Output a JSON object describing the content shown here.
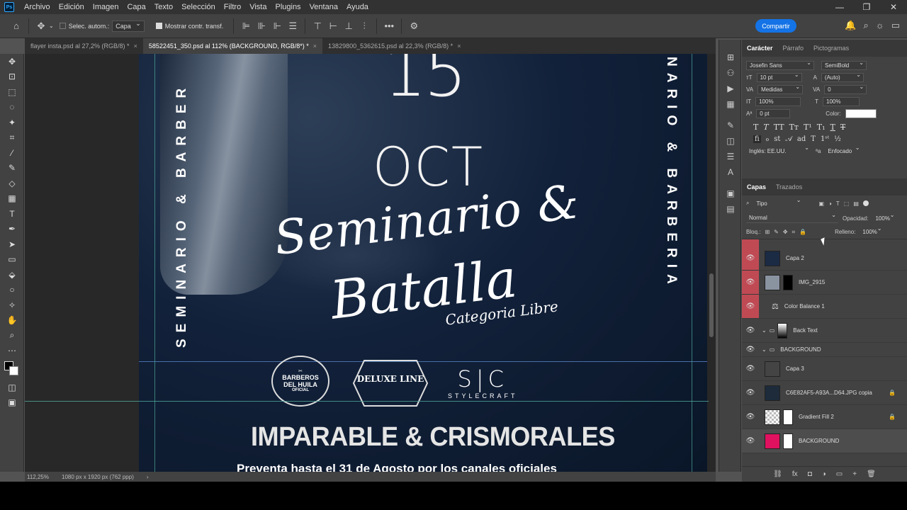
{
  "menubar": {
    "logo": "Ps",
    "items": [
      "Archivo",
      "Edición",
      "Imagen",
      "Capa",
      "Texto",
      "Selección",
      "Filtro",
      "Vista",
      "Plugins",
      "Ventana",
      "Ayuda"
    ],
    "minimize": "—",
    "restore": "❐",
    "close": "✕"
  },
  "options": {
    "auto_select_label": "Selec. autom.:",
    "auto_select_value": "Capa",
    "show_transform_label": "Mostrar contr. transf.",
    "more": "•••",
    "share_label": "Compartir"
  },
  "tabs": [
    {
      "label": "flayer insta.psd al 27,2% (RGB/8) *",
      "close": "×"
    },
    {
      "label": "58522451_350.psd al 112% (BACKGROUND, RGB/8*) *",
      "close": "×"
    },
    {
      "label": "13829800_5362615.psd al 22,3% (RGB/8) *",
      "close": "×"
    }
  ],
  "artwork": {
    "day": "15",
    "month": "OCT",
    "script_line1": "Seminario &",
    "script_line2": "Batalla",
    "script_line3": "Categoria Libre",
    "left_vertical": "SEMINARIO & BARBER",
    "right_vertical": "NARIO & BARBERIA",
    "logo1_line1": "BARBEROS",
    "logo1_line2": "DEL HUILA",
    "logo1_line3": "OFICIAL",
    "logo2": "DELUXE LINE",
    "logo3_big": "S|C",
    "logo3_small": "STYLECRAFT",
    "headline": "IMPARABLE & CRISMORALES",
    "subline": "Preventa hasta el 31 de Agosto por los canales oficiales"
  },
  "status": {
    "zoom": "112,25%",
    "doc_info": "1080 px x 1920 px (762 ppp)",
    "arrow": "›"
  },
  "character_panel": {
    "tabs": [
      "Carácter",
      "Párrafo",
      "Pictogramas"
    ],
    "font_family": "Josefin Sans",
    "font_style": "SemiBold",
    "font_size": "10 pt",
    "leading": "(Auto)",
    "kerning": "Medidas",
    "tracking": "0",
    "vertical_scale": "100%",
    "horizontal_scale": "100%",
    "baseline_shift": "0 pt",
    "color_label": "Color:",
    "color_value": "#ffffff",
    "type_buttons": [
      "T",
      "T",
      "TT",
      "Tт",
      "T¹",
      "T₁",
      "T",
      "T"
    ],
    "ot_buttons": [
      "ﬁ",
      "ℴ",
      "st",
      "𝒜",
      "ad",
      "T",
      "1ˢᵗ",
      "½"
    ],
    "language": "Inglés: EE.UU.",
    "aa_label": "ªa",
    "antialias": "Enfocado"
  },
  "layers_panel": {
    "tabs": [
      "Capas",
      "Trazados"
    ],
    "filter_label": "Tipo",
    "blend_mode": "Normal",
    "opacity_label": "Opacidad:",
    "opacity": "100%",
    "lock_label": "Bloq.:",
    "fill_label": "Relleno:",
    "fill": "100%",
    "layers": [
      {
        "name": "Capa 2",
        "red": true,
        "type": "image",
        "locked": false
      },
      {
        "name": "IMG_2915",
        "red": true,
        "type": "image-mask",
        "locked": false
      },
      {
        "name": "Color Balance 1",
        "red": true,
        "type": "adjustment",
        "locked": false
      },
      {
        "name": "Back Text",
        "red": false,
        "type": "group-mask",
        "locked": false
      },
      {
        "name": "BACKGROUND",
        "red": false,
        "type": "group",
        "locked": false
      },
      {
        "name": "Capa 3",
        "red": false,
        "type": "image",
        "locked": false
      },
      {
        "name": "C6E82AF5-A93A...D64.JPG copia",
        "red": false,
        "type": "image",
        "locked": true
      },
      {
        "name": "Gradient Fill 2",
        "red": false,
        "type": "gradient",
        "locked": true
      },
      {
        "name": "BACKGROUND",
        "red": false,
        "type": "fill",
        "locked": false
      }
    ],
    "footer_icons": [
      "⛓",
      "fx",
      "◘",
      "◑",
      "▭",
      "+",
      "🗑"
    ]
  },
  "colors": {
    "accent": "#1473e6",
    "red_layer": "#c04a54",
    "background_fill": "#e0115f"
  }
}
